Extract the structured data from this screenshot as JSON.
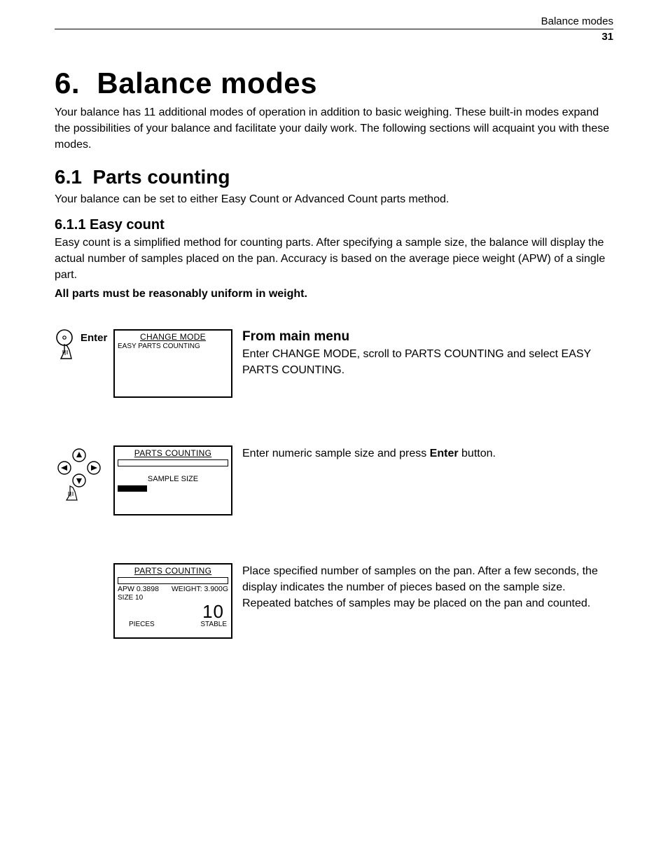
{
  "header": {
    "running_head": "Balance modes",
    "page_number": "31"
  },
  "chapter": {
    "number": "6.",
    "title": "Balance modes",
    "intro": "Your balance has 11 additional modes of operation in addition to basic weighing. These built-in modes expand the possibilities of your balance and facilitate your daily work. The following sections will acquaint you with these modes."
  },
  "section": {
    "number": "6.1",
    "title": "Parts counting",
    "intro": "Your balance can be set to either Easy Count or Advanced Count parts method."
  },
  "subsection": {
    "number": "6.1.1",
    "title": "Easy count",
    "body": "Easy count is a simplified method for counting parts. After specifying a sample size, the balance will display the actual number of samples placed on the pan. Accuracy is based on the average piece weight (APW) of a single part.",
    "note_bold": "All parts must be reasonably uniform in weight."
  },
  "steps": [
    {
      "icon_label": "Enter",
      "display": {
        "title": "CHANGE MODE",
        "line1_left": "EASY PARTS COUNTING"
      },
      "heading": "From main menu",
      "text_pre": "Enter CHANGE MODE, scroll to PARTS COUNTING and select EASY PARTS COUNTING."
    },
    {
      "display": {
        "title": "PARTS COUNTING",
        "label_center": "SAMPLE SIZE"
      },
      "text_pre": "Enter numeric sample size and press ",
      "text_bold": "Enter",
      "text_post": " button."
    },
    {
      "display": {
        "title": "PARTS COUNTING",
        "line1_left": "APW 0.3898",
        "line1_right": "WEIGHT: 3.900G",
        "line2_left": "SIZE 10",
        "big_number": "10",
        "bottom_left": "PIECES",
        "bottom_right": "STABLE"
      },
      "text_pre": "Place specified number of samples on the pan. After a few seconds, the display indicates the number of pieces based on the sample size. Repeated batches of samples may be placed on the pan and counted."
    }
  ]
}
